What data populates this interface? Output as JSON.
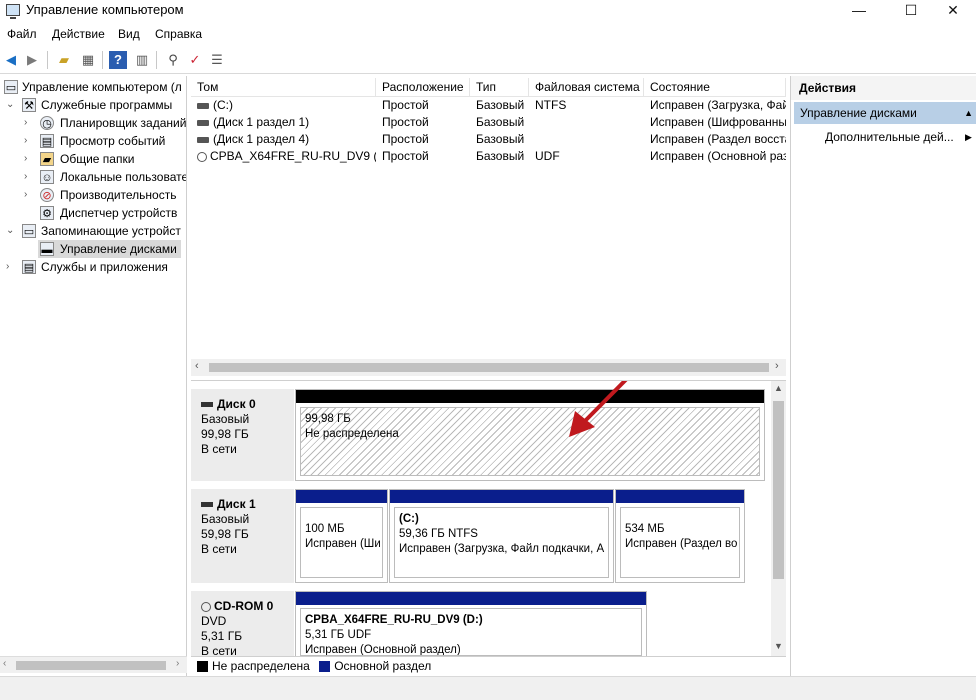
{
  "window": {
    "title": "Управление компьютером",
    "min": "—",
    "max": "☐",
    "close": "✕"
  },
  "menu": [
    "Файл",
    "Действие",
    "Вид",
    "Справка"
  ],
  "toolbar": [
    "back-icon",
    "forward-icon",
    "up-icon",
    "view-icon",
    "help-icon",
    "panel-icon",
    "connect-icon",
    "check-icon",
    "properties-icon"
  ],
  "tree": [
    {
      "label": "Управление компьютером (л"
    },
    {
      "label": "Служебные программы"
    },
    {
      "label": "Планировщик заданий"
    },
    {
      "label": "Просмотр событий"
    },
    {
      "label": "Общие папки"
    },
    {
      "label": "Локальные пользовате"
    },
    {
      "label": "Производительность"
    },
    {
      "label": "Диспетчер устройств"
    },
    {
      "label": "Запоминающие устройст"
    },
    {
      "label": "Управление дисками"
    },
    {
      "label": "Службы и приложения"
    }
  ],
  "volume_list": {
    "columns": [
      "Том",
      "Расположение",
      "Тип",
      "Файловая система",
      "Состояние"
    ],
    "rows": [
      [
        "(C:)",
        "Простой",
        "Базовый",
        "NTFS",
        "Исправен (Загрузка, Фай"
      ],
      [
        "(Диск 1 раздел 1)",
        "Простой",
        "Базовый",
        "",
        "Исправен (Шифрованны"
      ],
      [
        "(Диск 1 раздел 4)",
        "Простой",
        "Базовый",
        "",
        "Исправен (Раздел восста"
      ],
      [
        "CPBA_X64FRE_RU-RU_DV9 (D:)",
        "Простой",
        "Базовый",
        "UDF",
        "Исправен (Основной раз"
      ]
    ]
  },
  "disks": [
    {
      "name": "Диск 0",
      "type": "Базовый",
      "size": "99,98 ГБ",
      "status": "В сети",
      "partitions": [
        {
          "title": "",
          "line1": "99,98 ГБ",
          "line2": "Не распределена"
        }
      ]
    },
    {
      "name": "Диск 1",
      "type": "Базовый",
      "size": "59,98 ГБ",
      "status": "В сети",
      "partitions": [
        {
          "title": "",
          "line1": "100 МБ",
          "line2": "Исправен (Ши"
        },
        {
          "title": "(C:)",
          "line1": "59,36 ГБ NTFS",
          "line2": "Исправен (Загрузка, Файл подкачки, А"
        },
        {
          "title": "",
          "line1": "534 МБ",
          "line2": "Исправен (Раздел во"
        }
      ]
    },
    {
      "name": "CD-ROM 0",
      "type": "DVD",
      "size": "5,31 ГБ",
      "status": "В сети",
      "partitions": [
        {
          "title": "CPBA_X64FRE_RU-RU_DV9  (D:)",
          "line1": "5,31 ГБ UDF",
          "line2": "Исправен (Основной раздел)"
        }
      ]
    }
  ],
  "legend": {
    "unallocated": "Не распределена",
    "primary": "Основной раздел"
  },
  "actions": {
    "title": "Действия",
    "section": "Управление дисками",
    "more": "Дополнительные дей..."
  },
  "colors": {
    "primary_bar": "#0a1e8c",
    "unallocated_bar": "#000000",
    "selection": "#b8cfe6",
    "arrow": "#c0191e"
  }
}
